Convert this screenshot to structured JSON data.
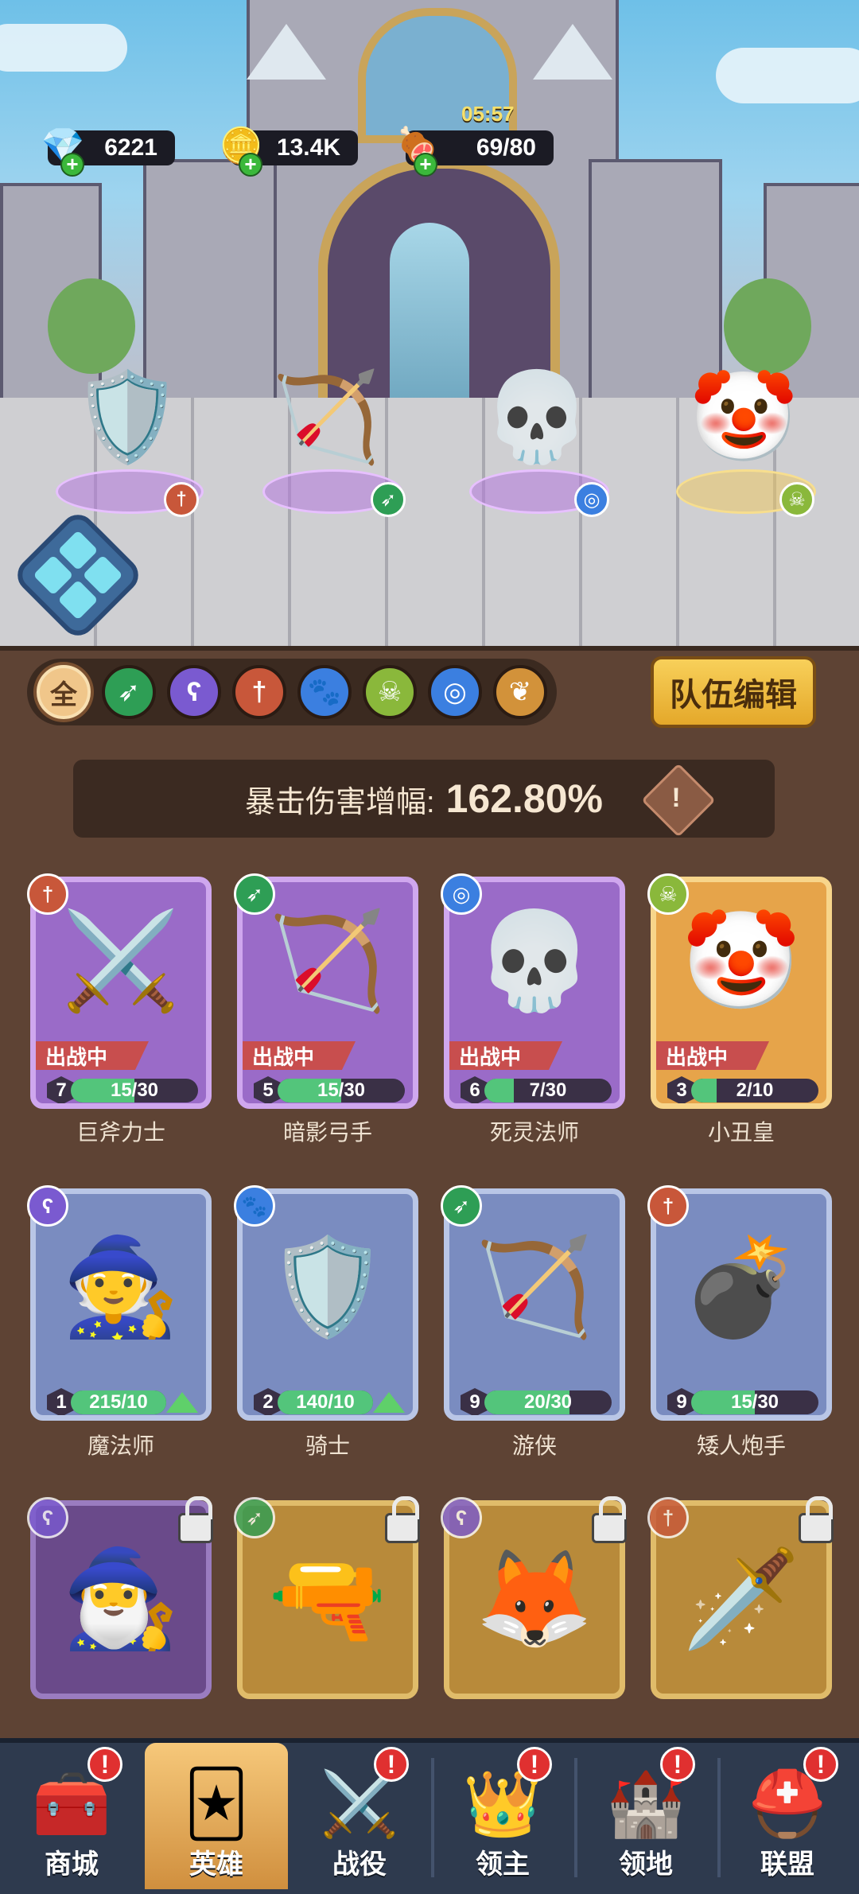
{
  "resources": {
    "gems": "6221",
    "gold": "13.4K",
    "stamina": "69/80",
    "stamina_timer": "05:57"
  },
  "filters": {
    "all_label": "全",
    "items": [
      "all",
      "archer",
      "mage",
      "warrior",
      "beast",
      "skull",
      "spiral",
      "wing"
    ],
    "selected": "all"
  },
  "team_edit_label": "队伍编辑",
  "crit": {
    "label": "暴击伤害增幅:",
    "value": "162.80%",
    "info_icon": "!"
  },
  "heroes": [
    {
      "name": "巨斧力士",
      "status": "出战中",
      "level": "7",
      "progress": "15/30",
      "progress_frac": 0.5,
      "rarity": "epic",
      "class": "warrior-icon"
    },
    {
      "name": "暗影弓手",
      "status": "出战中",
      "level": "5",
      "progress": "15/30",
      "progress_frac": 0.5,
      "rarity": "epic",
      "class": "archer-icon"
    },
    {
      "name": "死灵法师",
      "status": "出战中",
      "level": "6",
      "progress": "7/30",
      "progress_frac": 0.23,
      "rarity": "epic",
      "class": "spiral-icon"
    },
    {
      "name": "小丑皇",
      "status": "出战中",
      "level": "3",
      "progress": "2/10",
      "progress_frac": 0.2,
      "rarity": "legendary",
      "class": "skull-icon"
    },
    {
      "name": "魔法师",
      "status": "",
      "level": "1",
      "progress": "215/10",
      "progress_frac": 1.0,
      "rarity": "rare",
      "class": "mage-icon",
      "upgrade": true
    },
    {
      "name": "骑士",
      "status": "",
      "level": "2",
      "progress": "140/10",
      "progress_frac": 1.0,
      "rarity": "rare",
      "class": "paw-icon",
      "upgrade": true
    },
    {
      "name": "游侠",
      "status": "",
      "level": "9",
      "progress": "20/30",
      "progress_frac": 0.67,
      "rarity": "rare",
      "class": "archer-icon"
    },
    {
      "name": "矮人炮手",
      "status": "",
      "level": "9",
      "progress": "15/30",
      "progress_frac": 0.5,
      "rarity": "rare",
      "class": "warrior-icon"
    }
  ],
  "nav": [
    {
      "label": "商城",
      "icon": "chest-icon",
      "alert": "!"
    },
    {
      "label": "英雄",
      "icon": "cards-icon",
      "alert": "",
      "selected": true
    },
    {
      "label": "战役",
      "icon": "swords-icon",
      "alert": "!"
    },
    {
      "label": "领主",
      "icon": "crown-icon",
      "alert": "!"
    },
    {
      "label": "领地",
      "icon": "castle-icon",
      "alert": "!"
    },
    {
      "label": "联盟",
      "icon": "helmet-icon",
      "alert": "!"
    }
  ],
  "colors": {
    "epic": "#9a6bc8",
    "legendary": "#e6a44a",
    "rare": "#7a8cc0",
    "progress": "#53c57b",
    "deploy": "#c84e4e"
  }
}
